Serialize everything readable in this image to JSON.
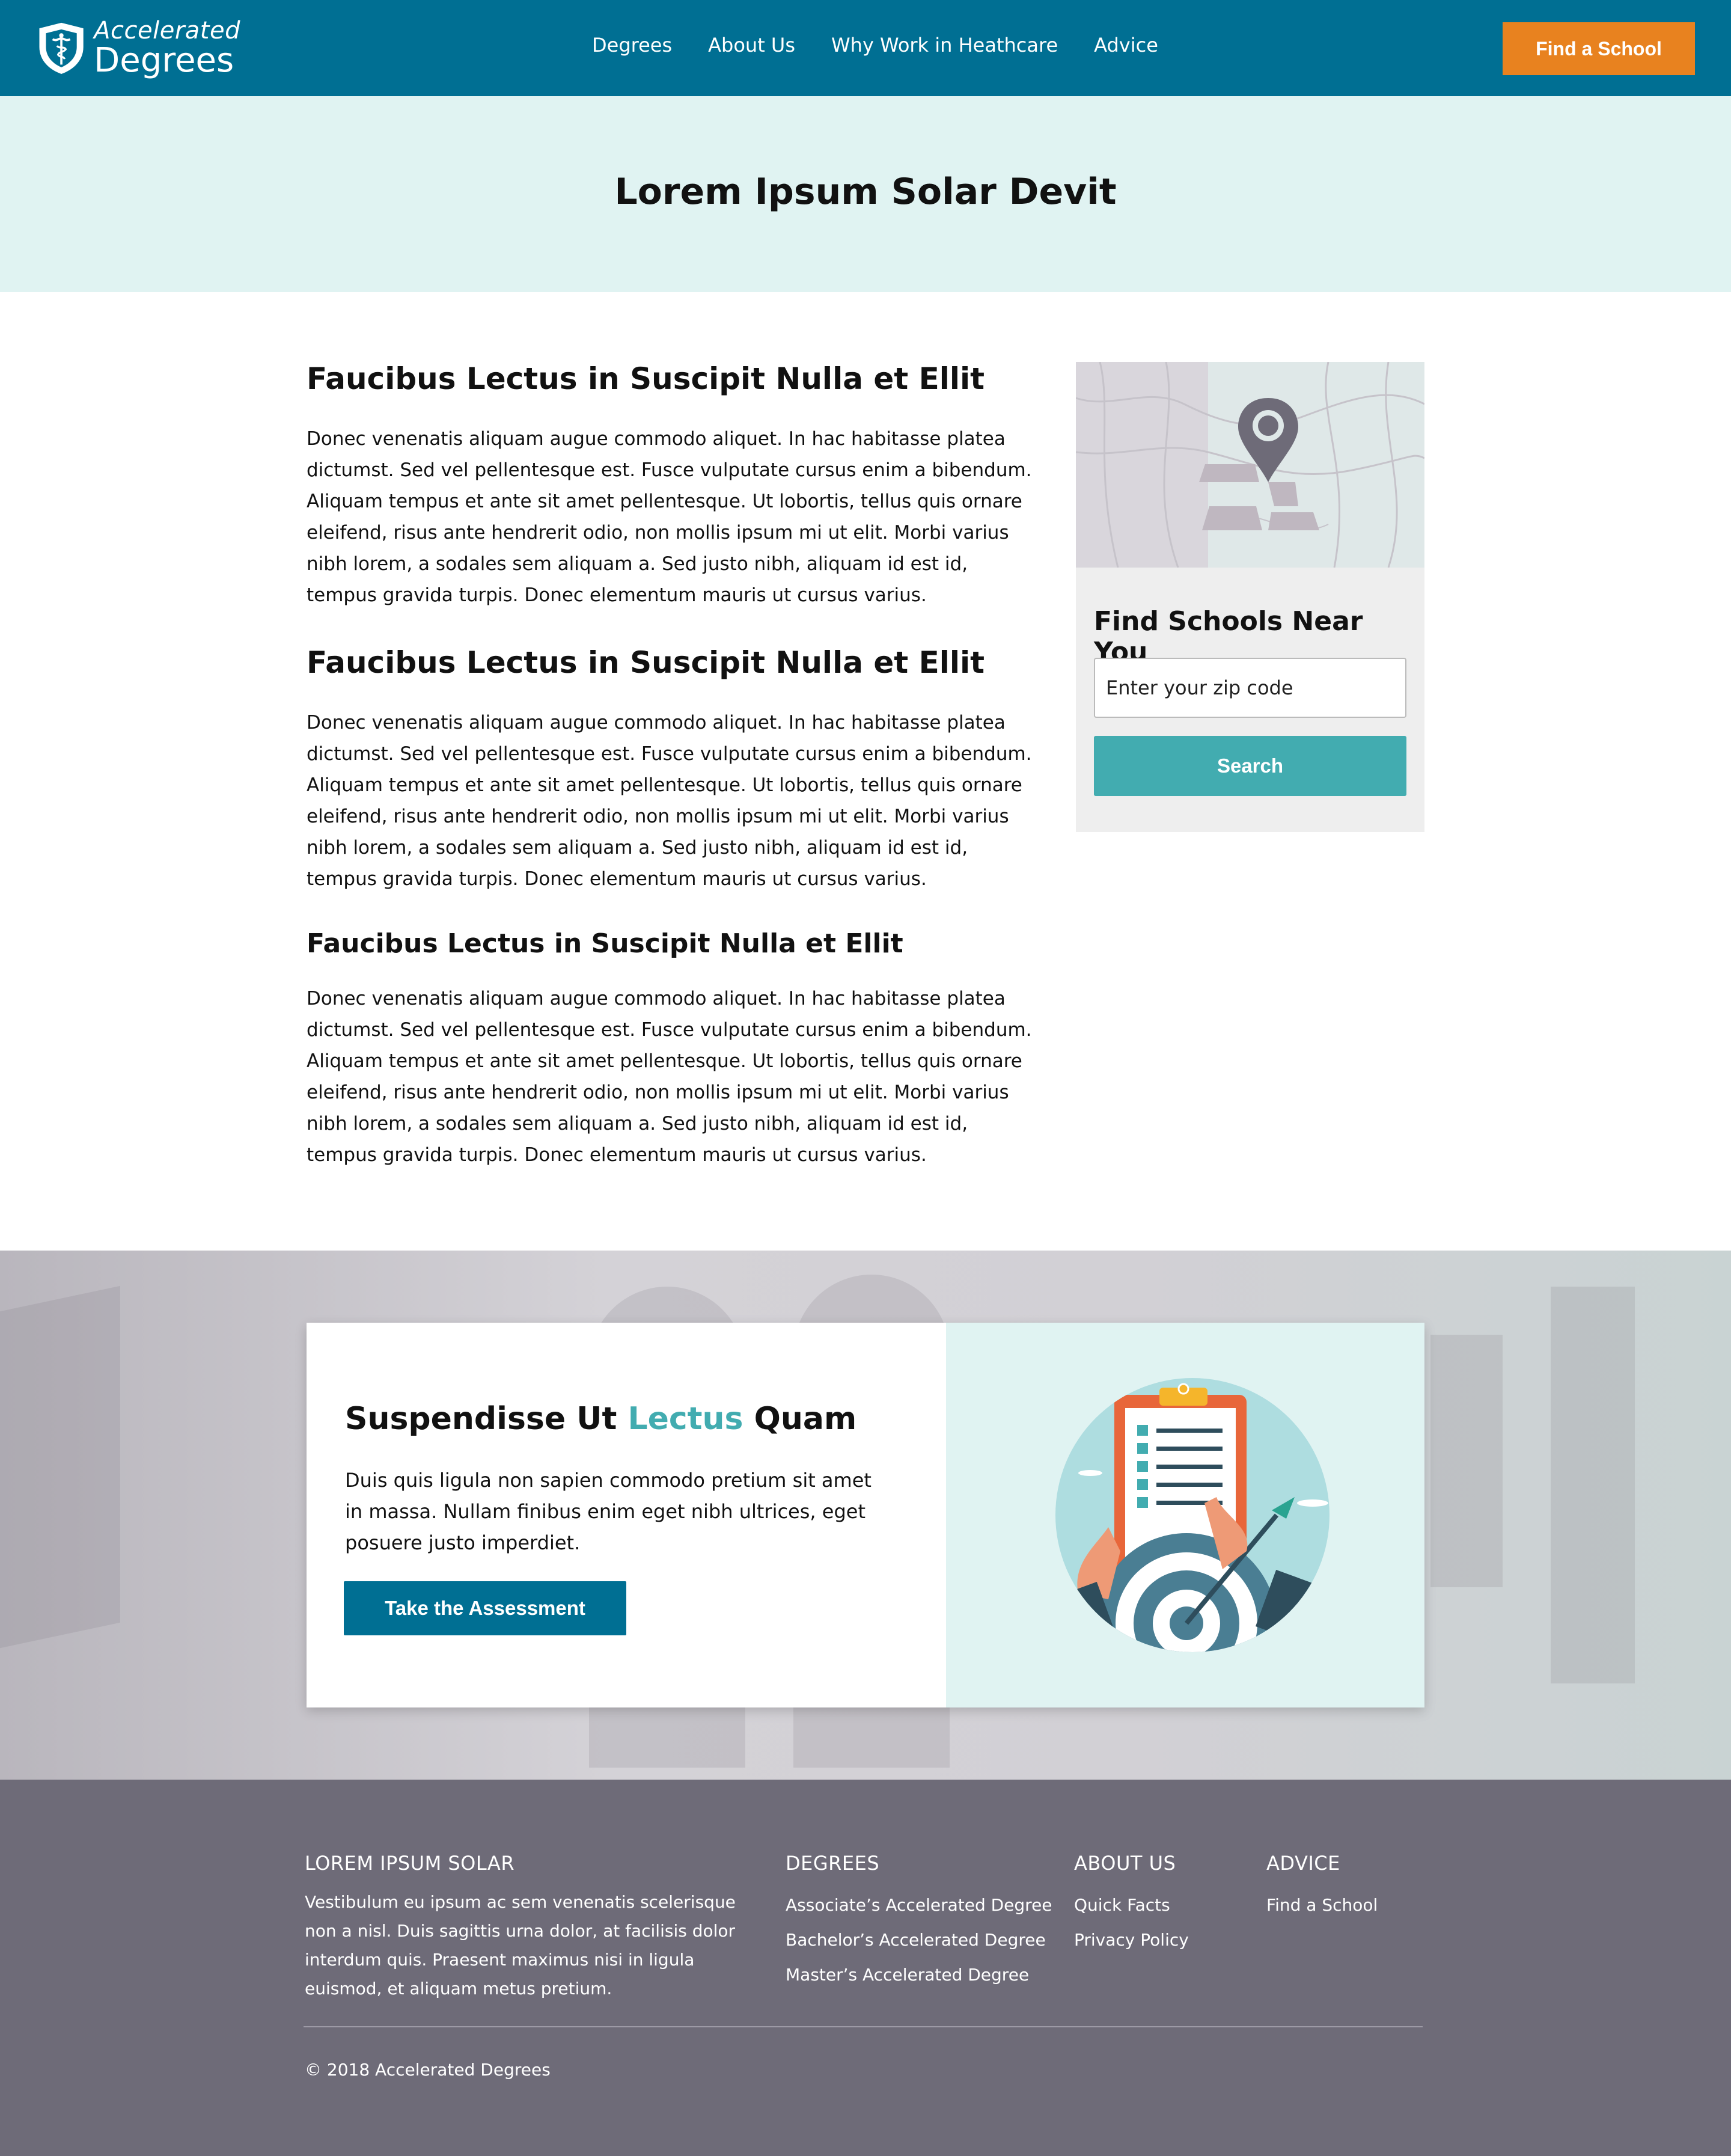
{
  "header": {
    "logo": {
      "line1": "Accelerated",
      "line2": "Degrees"
    },
    "nav": [
      {
        "label": "Degrees"
      },
      {
        "label": "About Us"
      },
      {
        "label": "Why Work in Heathcare"
      },
      {
        "label": "Advice"
      }
    ],
    "cta_label": "Find a School",
    "colors": {
      "background": "#006f93",
      "cta": "#e8821f"
    }
  },
  "hero": {
    "title": "Lorem Ipsum Solar Devit",
    "background": "#e0f3f2"
  },
  "article": {
    "sections": [
      {
        "heading": "Faucibus Lectus in Suscipit Nulla et Ellit",
        "body": "Donec venenatis aliquam augue commodo aliquet. In hac habitasse platea dictumst. Sed vel pellentesque est. Fusce vulputate cursus enim a bibendum. Aliquam tempus et ante sit amet pellentesque. Ut lobortis, tellus quis ornare eleifend, risus ante hendrerit odio, non mollis ipsum mi ut elit. Morbi varius nibh lorem, a sodales sem aliquam a. Sed justo nibh, aliquam id est id, tempus gravida turpis. Donec elementum mauris ut cursus varius."
      },
      {
        "heading": "Faucibus Lectus in Suscipit Nulla et Ellit",
        "body": "Donec venenatis aliquam augue commodo aliquet. In hac habitasse platea dictumst. Sed vel pellentesque est. Fusce vulputate cursus enim a bibendum. Aliquam tempus et ante sit amet pellentesque. Ut lobortis, tellus quis ornare eleifend, risus ante hendrerit odio, non mollis ipsum mi ut elit. Morbi varius nibh lorem, a sodales sem aliquam a. Sed justo nibh, aliquam id est id, tempus gravida turpis. Donec elementum mauris ut cursus varius."
      },
      {
        "heading": "Faucibus Lectus in Suscipit Nulla et Ellit",
        "body": "Donec venenatis aliquam augue commodo aliquet. In hac habitasse platea dictumst. Sed vel pellentesque est. Fusce vulputate cursus enim a bibendum. Aliquam tempus et ante sit amet pellentesque. Ut lobortis, tellus quis ornare eleifend, risus ante hendrerit odio, non mollis ipsum mi ut elit. Morbi varius nibh lorem, a sodales sem aliquam a. Sed justo nibh, aliquam id est id, tempus gravida turpis. Donec elementum mauris ut cursus varius."
      }
    ]
  },
  "sidebar": {
    "title": "Find Schools Near You",
    "zip_placeholder": "Enter your zip code",
    "zip_value": "",
    "search_label": "Search",
    "icon": "map-pin-icon",
    "accent": "#42acb0"
  },
  "cta": {
    "title_before": "Suspendisse Ut",
    "title_accent": "Lectus",
    "title_after": "Quam",
    "body": "Duis quis ligula non sapien commodo pretium sit amet in massa. Nullam finibus enim eget nibh ultrices, eget posuere justo imperdiet.",
    "button_label": "Take the Assessment",
    "illustration": "clipboard-target-icon"
  },
  "footer": {
    "about": {
      "heading": "LOREM IPSUM SOLAR",
      "text": "Vestibulum eu ipsum ac sem venenatis scelerisque non a nisl. Duis sagittis urna dolor, at facilisis dolor interdum quis. Praesent maximus nisi in ligula euismod, et aliquam metus pretium."
    },
    "degrees": {
      "heading": "DEGREES",
      "links": [
        "Associate’s Accelerated Degree",
        "Bachelor’s Accelerated Degree",
        "Master’s Accelerated Degree"
      ]
    },
    "about_us": {
      "heading": "ABOUT US",
      "links": [
        "Quick Facts",
        "Privacy Policy"
      ]
    },
    "advice": {
      "heading": "ADVICE",
      "links": [
        "Find a School"
      ]
    },
    "copyright": "© 2018 Accelerated Degrees",
    "background": "#6e6b78"
  }
}
